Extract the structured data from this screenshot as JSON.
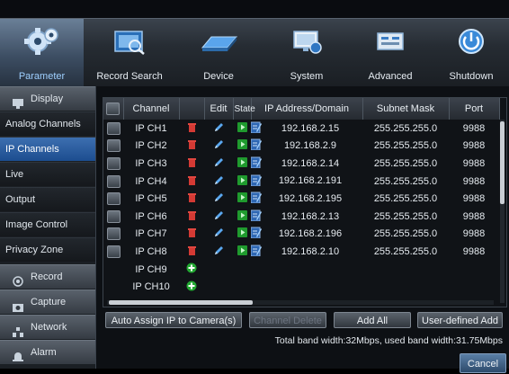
{
  "toolbar": {
    "items": [
      {
        "label": "Parameter",
        "icon": "gears-icon"
      },
      {
        "label": "Record Search",
        "icon": "record-search-icon"
      },
      {
        "label": "Device",
        "icon": "hard-drive-icon"
      },
      {
        "label": "System",
        "icon": "monitor-settings-icon"
      },
      {
        "label": "Advanced",
        "icon": "advanced-panel-icon"
      },
      {
        "label": "Shutdown",
        "icon": "power-icon"
      }
    ]
  },
  "sidebar": {
    "display": "Display",
    "items": [
      "Analog Channels",
      "IP Channels",
      "Live",
      "Output",
      "Image Control",
      "Privacy Zone"
    ],
    "record": "Record",
    "capture": "Capture",
    "network": "Network",
    "alarm": "Alarm"
  },
  "table": {
    "headers": {
      "channel": "Channel",
      "edit": "Edit",
      "state": "State",
      "ip": "IP Address/Domain",
      "mask": "Subnet Mask",
      "port": "Port"
    },
    "rows": [
      {
        "channel": "IP CH1",
        "ip": "192.168.2.15",
        "mask": "255.255.255.0",
        "port": "9988"
      },
      {
        "channel": "IP CH2",
        "ip": "192.168.2.9",
        "mask": "255.255.255.0",
        "port": "9988"
      },
      {
        "channel": "IP CH3",
        "ip": "192.168.2.14",
        "mask": "255.255.255.0",
        "port": "9988"
      },
      {
        "channel": "IP CH4",
        "ip": "192.168.2.191",
        "mask": "255.255.255.0",
        "port": "9988"
      },
      {
        "channel": "IP CH5",
        "ip": "192.168.2.195",
        "mask": "255.255.255.0",
        "port": "9988"
      },
      {
        "channel": "IP CH6",
        "ip": "192.168.2.13",
        "mask": "255.255.255.0",
        "port": "9988"
      },
      {
        "channel": "IP CH7",
        "ip": "192.168.2.196",
        "mask": "255.255.255.0",
        "port": "9988"
      },
      {
        "channel": "IP CH8",
        "ip": "192.168.2.10",
        "mask": "255.255.255.0",
        "port": "9988"
      }
    ],
    "empty_rows": [
      "IP CH9",
      "IP CH10"
    ]
  },
  "buttons": {
    "auto_assign": "Auto Assign IP to Camera(s)",
    "channel_delete": "Channel Delete",
    "add_all": "Add All",
    "user_defined_add": "User-defined Add",
    "cancel": "Cancel"
  },
  "status": {
    "bandwidth": "Total band width:32Mbps, used band width:31.75Mbps"
  },
  "colors": {
    "accent_blue": "#2f63a8",
    "delete_red": "#d43a34",
    "state_green": "#22a832"
  }
}
